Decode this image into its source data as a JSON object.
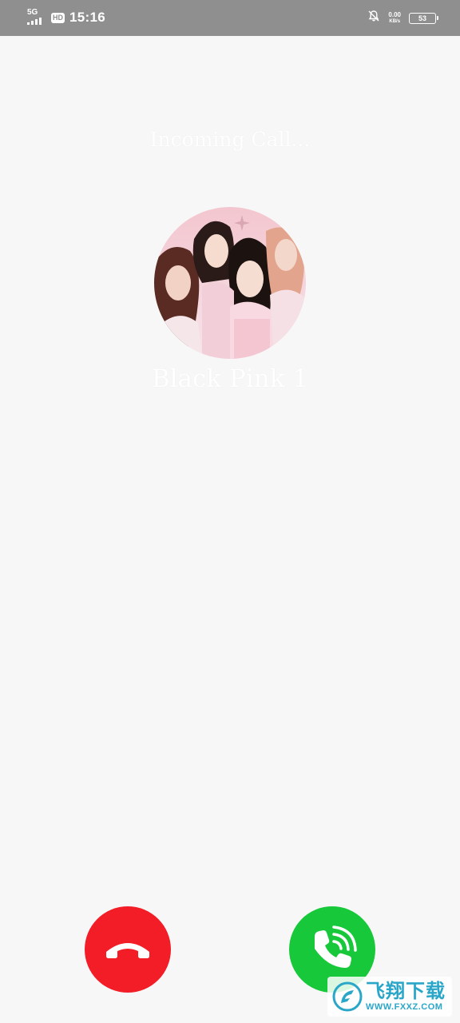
{
  "status_bar": {
    "network_label": "5G",
    "hd_label": "HD",
    "time": "15:16",
    "speed_value": "0.00",
    "speed_unit": "KB/s",
    "battery": "53"
  },
  "call": {
    "status": "Incoming Call...",
    "caller_name": "Black Pink 1"
  },
  "buttons": {
    "decline_icon": "phone-hangup-icon",
    "accept_icon": "phone-ringing-icon"
  },
  "watermark": {
    "text": "飞翔下载",
    "url": "WWW.FXXZ.COM"
  },
  "colors": {
    "decline": "#f21d27",
    "accept": "#17c93a",
    "status_bar": "#8f8f8f",
    "background": "#f7f7f7"
  }
}
